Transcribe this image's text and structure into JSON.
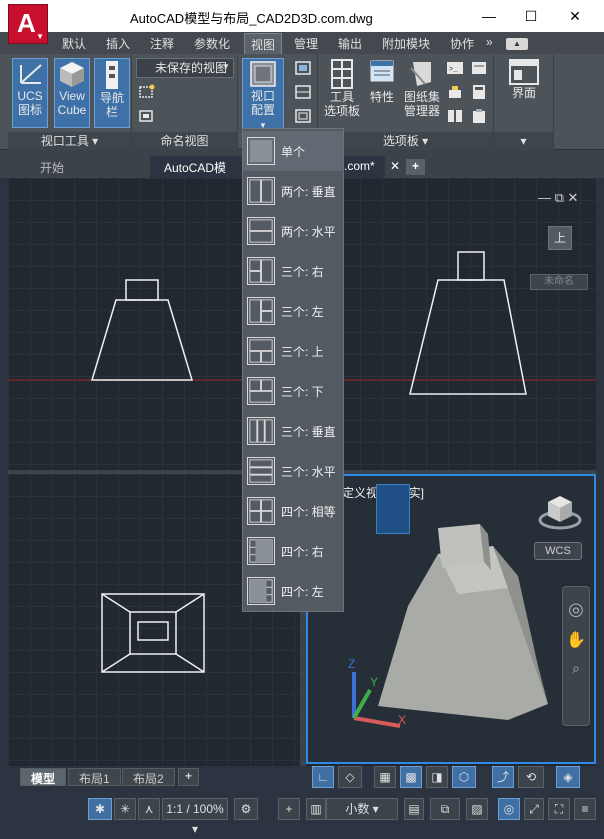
{
  "window": {
    "title": "AutoCAD模型与布局_CAD2D3D.com.dwg",
    "app_letter": "A",
    "minimize_glyph": "—",
    "maximize_glyph": "☐",
    "close_glyph": "✕"
  },
  "ribbon_tabs": [
    "默认",
    "插入",
    "注释",
    "参数化",
    "视图",
    "管理",
    "输出",
    "附加模块",
    "协作",
    "»"
  ],
  "ribbon_active_tab": "视图",
  "ribbon": {
    "viewport_tools": {
      "label": "视口工具",
      "ucs_line1": "UCS",
      "ucs_line2": "图标",
      "viewcube_line1": "View",
      "viewcube_line2": "Cube",
      "navbar": "导航栏"
    },
    "named_views": {
      "label": "命名视图",
      "dropdown_value": "未保存的视图"
    },
    "model_viewports": {
      "config_line1": "视口",
      "config_line2": "配置"
    },
    "palettes": {
      "label": "选项板",
      "tools_line1": "工具",
      "tools_line2": "选项板",
      "properties": "特性",
      "sheetset_line1": "图纸集",
      "sheetset_line2": "管理器"
    },
    "interface": {
      "label": "界面"
    }
  },
  "doc_tabs": {
    "start": "开始",
    "active_doc": "AutoCAD模型",
    "active_doc_tail": ".com*",
    "add": "+"
  },
  "viewport_menu": {
    "items": [
      {
        "label": "单个",
        "icon": "single-viewport-icon"
      },
      {
        "label": "两个: 垂直",
        "icon": "two-vertical-icon"
      },
      {
        "label": "两个: 水平",
        "icon": "two-horizontal-icon"
      },
      {
        "label": "三个: 右",
        "icon": "three-right-icon"
      },
      {
        "label": "三个: 左",
        "icon": "three-left-icon"
      },
      {
        "label": "三个: 上",
        "icon": "three-above-icon"
      },
      {
        "label": "三个: 下",
        "icon": "three-below-icon"
      },
      {
        "label": "三个: 垂直",
        "icon": "three-vertical-icon"
      },
      {
        "label": "三个: 水平",
        "icon": "three-horizontal-icon"
      },
      {
        "label": "四个: 相等",
        "icon": "four-equal-icon"
      },
      {
        "label": "四个: 右",
        "icon": "four-right-icon"
      },
      {
        "label": "四个: 左",
        "icon": "four-left-icon"
      }
    ]
  },
  "viewports": {
    "top_right_caption": "上",
    "wcs_top": "未命名",
    "bottom_right_caption": "定义视图][真实]",
    "wcs_label": "WCS"
  },
  "layout_tabs": {
    "model": "模型",
    "layout1": "布局1",
    "layout2": "布局2",
    "add": "+"
  },
  "status": {
    "scale": "1:1 / 100%",
    "units": "小数"
  },
  "colors": {
    "accent": "#3d71a8",
    "app_red": "#c8102e",
    "viewport_active_border": "#2e8ae6"
  }
}
